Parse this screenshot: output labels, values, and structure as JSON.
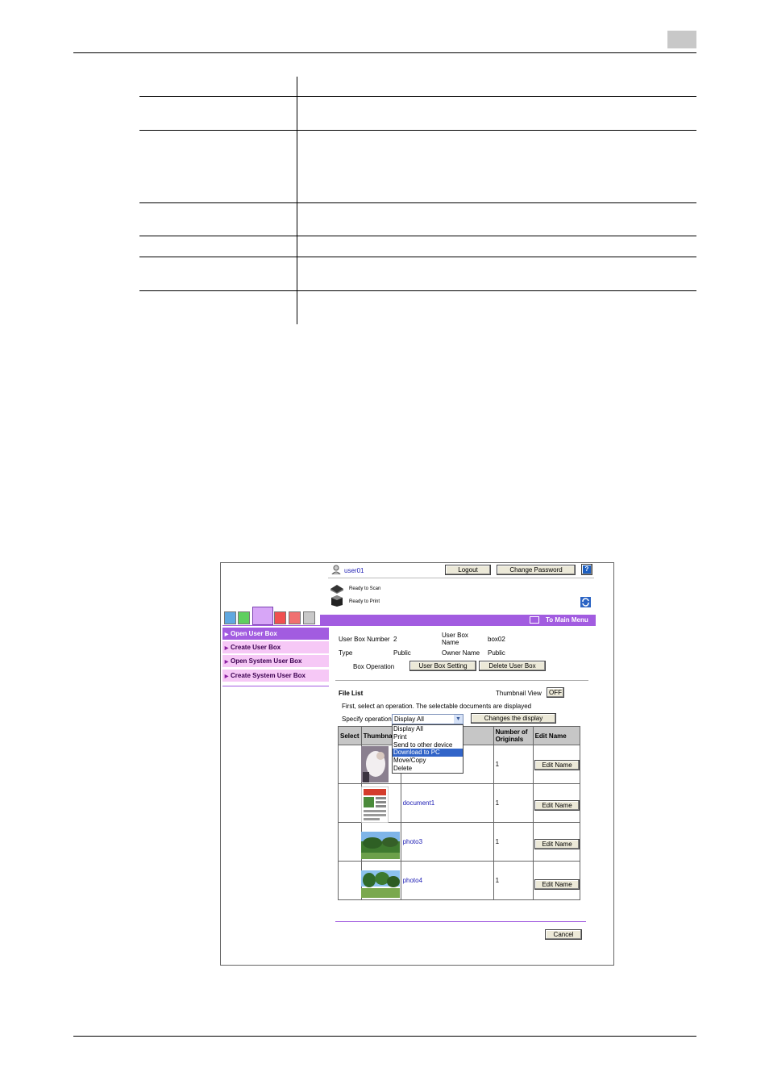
{
  "page": {
    "header_rule": true
  },
  "screenshot": {
    "user": "user01",
    "logout_label": "Logout",
    "change_password_label": "Change Password",
    "help_label": "?",
    "scan_status": "Ready to Scan",
    "print_status": "Ready to Print",
    "main_menu_label": "To Main Menu",
    "sidebar": [
      {
        "label": "Open User Box",
        "active": true
      },
      {
        "label": "Create User Box",
        "active": false
      },
      {
        "label": "Open System User Box",
        "active": false
      },
      {
        "label": "Create System User Box",
        "active": false
      }
    ],
    "info": {
      "box_number_label": "User Box Number",
      "box_number_value": "2",
      "box_name_label_1": "User Box",
      "box_name_label_2": "Name",
      "box_name_value": "box02",
      "type_label": "Type",
      "type_value": "Public",
      "owner_label": "Owner Name",
      "owner_value": "Public",
      "box_operation_label": "Box Operation",
      "setting_button": "User Box Setting",
      "delete_button": "Delete User Box"
    },
    "file_list": {
      "title": "File List",
      "thumbnail_view_label": "Thumbnail View",
      "thumbnail_view_value": "OFF",
      "instruction": "First, select an operation. The selectable documents are displayed",
      "specify_label": "Specify operation",
      "select_value": "Display All",
      "changes_button": "Changes the display",
      "options": [
        "Display All",
        "Print",
        "Send to other device",
        "Download to PC",
        "Move/Copy",
        "Delete"
      ],
      "selected_option_index": 3,
      "columns": {
        "select": "Select",
        "thumbnail": "Thumbnai",
        "originals_1": "Number of",
        "originals_2": "Originals",
        "edit": "Edit Name"
      },
      "rows": [
        {
          "name": "",
          "originals": "1",
          "edit_label": "Edit Name"
        },
        {
          "name": "document1",
          "originals": "1",
          "edit_label": "Edit Name"
        },
        {
          "name": "photo3",
          "originals": "1",
          "edit_label": "Edit Name"
        },
        {
          "name": "photo4",
          "originals": "1",
          "edit_label": "Edit Name"
        }
      ]
    },
    "cancel_label": "Cancel"
  },
  "colors": {
    "accent_purple": "#a25ce0",
    "sidebar_pink": "#f6c8f6",
    "link_blue": "#1b1bb3",
    "dropdown_selected": "#3164c8"
  }
}
